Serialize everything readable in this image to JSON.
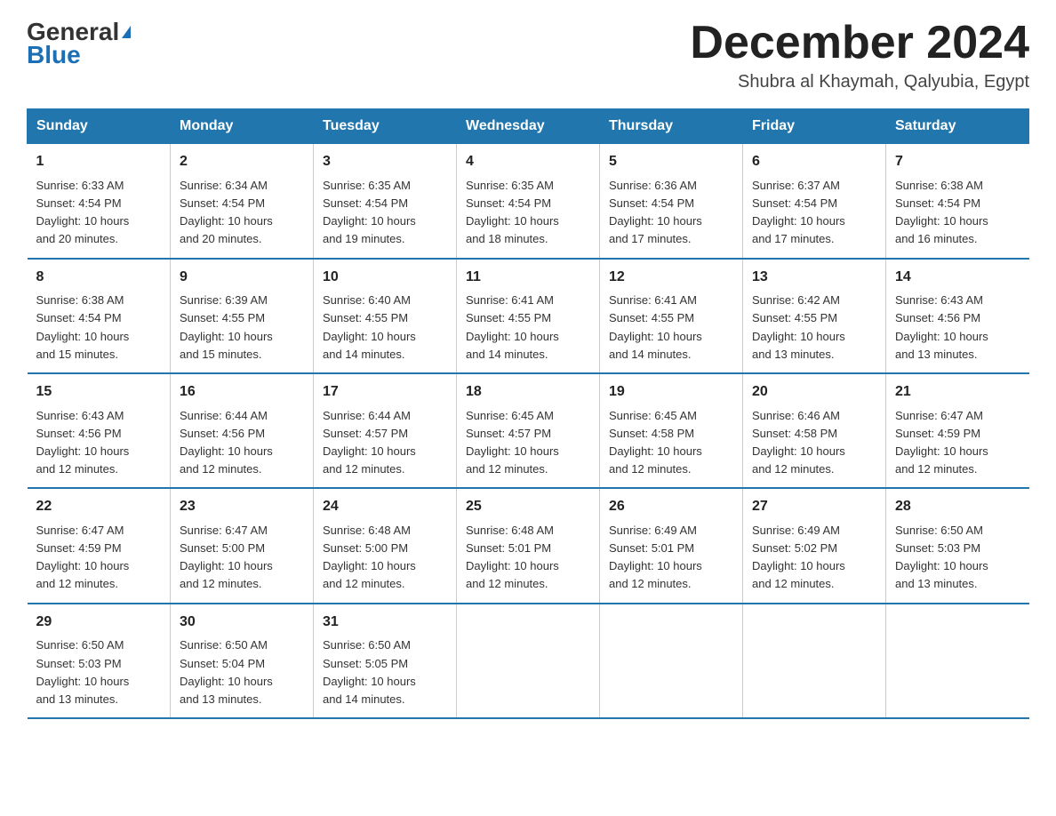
{
  "logo": {
    "general": "General",
    "blue": "Blue"
  },
  "header": {
    "month": "December 2024",
    "location": "Shubra al Khaymah, Qalyubia, Egypt"
  },
  "weekdays": [
    "Sunday",
    "Monday",
    "Tuesday",
    "Wednesday",
    "Thursday",
    "Friday",
    "Saturday"
  ],
  "weeks": [
    [
      {
        "day": "1",
        "sunrise": "6:33 AM",
        "sunset": "4:54 PM",
        "daylight": "10 hours and 20 minutes."
      },
      {
        "day": "2",
        "sunrise": "6:34 AM",
        "sunset": "4:54 PM",
        "daylight": "10 hours and 20 minutes."
      },
      {
        "day": "3",
        "sunrise": "6:35 AM",
        "sunset": "4:54 PM",
        "daylight": "10 hours and 19 minutes."
      },
      {
        "day": "4",
        "sunrise": "6:35 AM",
        "sunset": "4:54 PM",
        "daylight": "10 hours and 18 minutes."
      },
      {
        "day": "5",
        "sunrise": "6:36 AM",
        "sunset": "4:54 PM",
        "daylight": "10 hours and 17 minutes."
      },
      {
        "day": "6",
        "sunrise": "6:37 AM",
        "sunset": "4:54 PM",
        "daylight": "10 hours and 17 minutes."
      },
      {
        "day": "7",
        "sunrise": "6:38 AM",
        "sunset": "4:54 PM",
        "daylight": "10 hours and 16 minutes."
      }
    ],
    [
      {
        "day": "8",
        "sunrise": "6:38 AM",
        "sunset": "4:54 PM",
        "daylight": "10 hours and 15 minutes."
      },
      {
        "day": "9",
        "sunrise": "6:39 AM",
        "sunset": "4:55 PM",
        "daylight": "10 hours and 15 minutes."
      },
      {
        "day": "10",
        "sunrise": "6:40 AM",
        "sunset": "4:55 PM",
        "daylight": "10 hours and 14 minutes."
      },
      {
        "day": "11",
        "sunrise": "6:41 AM",
        "sunset": "4:55 PM",
        "daylight": "10 hours and 14 minutes."
      },
      {
        "day": "12",
        "sunrise": "6:41 AM",
        "sunset": "4:55 PM",
        "daylight": "10 hours and 14 minutes."
      },
      {
        "day": "13",
        "sunrise": "6:42 AM",
        "sunset": "4:55 PM",
        "daylight": "10 hours and 13 minutes."
      },
      {
        "day": "14",
        "sunrise": "6:43 AM",
        "sunset": "4:56 PM",
        "daylight": "10 hours and 13 minutes."
      }
    ],
    [
      {
        "day": "15",
        "sunrise": "6:43 AM",
        "sunset": "4:56 PM",
        "daylight": "10 hours and 12 minutes."
      },
      {
        "day": "16",
        "sunrise": "6:44 AM",
        "sunset": "4:56 PM",
        "daylight": "10 hours and 12 minutes."
      },
      {
        "day": "17",
        "sunrise": "6:44 AM",
        "sunset": "4:57 PM",
        "daylight": "10 hours and 12 minutes."
      },
      {
        "day": "18",
        "sunrise": "6:45 AM",
        "sunset": "4:57 PM",
        "daylight": "10 hours and 12 minutes."
      },
      {
        "day": "19",
        "sunrise": "6:45 AM",
        "sunset": "4:58 PM",
        "daylight": "10 hours and 12 minutes."
      },
      {
        "day": "20",
        "sunrise": "6:46 AM",
        "sunset": "4:58 PM",
        "daylight": "10 hours and 12 minutes."
      },
      {
        "day": "21",
        "sunrise": "6:47 AM",
        "sunset": "4:59 PM",
        "daylight": "10 hours and 12 minutes."
      }
    ],
    [
      {
        "day": "22",
        "sunrise": "6:47 AM",
        "sunset": "4:59 PM",
        "daylight": "10 hours and 12 minutes."
      },
      {
        "day": "23",
        "sunrise": "6:47 AM",
        "sunset": "5:00 PM",
        "daylight": "10 hours and 12 minutes."
      },
      {
        "day": "24",
        "sunrise": "6:48 AM",
        "sunset": "5:00 PM",
        "daylight": "10 hours and 12 minutes."
      },
      {
        "day": "25",
        "sunrise": "6:48 AM",
        "sunset": "5:01 PM",
        "daylight": "10 hours and 12 minutes."
      },
      {
        "day": "26",
        "sunrise": "6:49 AM",
        "sunset": "5:01 PM",
        "daylight": "10 hours and 12 minutes."
      },
      {
        "day": "27",
        "sunrise": "6:49 AM",
        "sunset": "5:02 PM",
        "daylight": "10 hours and 12 minutes."
      },
      {
        "day": "28",
        "sunrise": "6:50 AM",
        "sunset": "5:03 PM",
        "daylight": "10 hours and 13 minutes."
      }
    ],
    [
      {
        "day": "29",
        "sunrise": "6:50 AM",
        "sunset": "5:03 PM",
        "daylight": "10 hours and 13 minutes."
      },
      {
        "day": "30",
        "sunrise": "6:50 AM",
        "sunset": "5:04 PM",
        "daylight": "10 hours and 13 minutes."
      },
      {
        "day": "31",
        "sunrise": "6:50 AM",
        "sunset": "5:05 PM",
        "daylight": "10 hours and 14 minutes."
      },
      null,
      null,
      null,
      null
    ]
  ],
  "labels": {
    "sunrise": "Sunrise:",
    "sunset": "Sunset:",
    "daylight": "Daylight:"
  }
}
